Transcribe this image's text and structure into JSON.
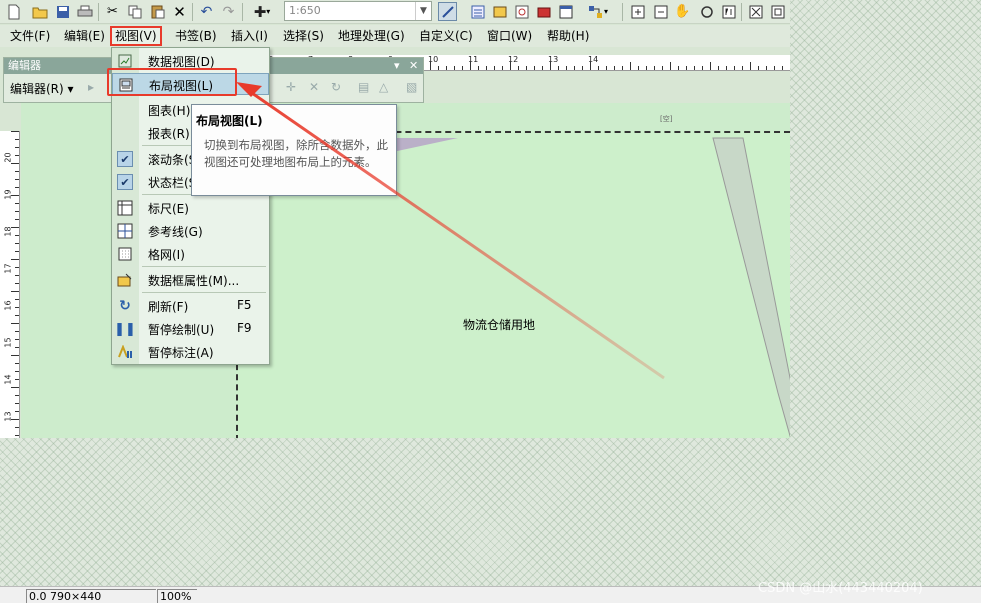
{
  "toolbar": {
    "scale_value": "1:650",
    "icons": [
      "new-icon",
      "open-icon",
      "save-icon",
      "print-icon",
      "cut-icon",
      "copy-icon",
      "paste-icon",
      "delete-icon",
      "undo-icon",
      "redo-icon",
      "add-data-icon",
      "editor-toolbar-icon",
      "table-of-contents-icon",
      "catalog-icon",
      "search-window-icon",
      "arctoolbox-icon",
      "python-icon",
      "model-builder-icon",
      "zoom-in-icon",
      "zoom-out-icon",
      "pan-icon",
      "full-extent-icon",
      "fixed-zoom-icon",
      "select-elements-icon",
      "page-extent-icon"
    ]
  },
  "menubar": {
    "items": [
      "文件(F)",
      "编辑(E)",
      "视图(V)",
      "书签(B)",
      "插入(I)",
      "选择(S)",
      "地理处理(G)",
      "自定义(C)",
      "窗口(W)",
      "帮助(H)"
    ]
  },
  "editor_toolbar": {
    "title": "编辑器",
    "editor_menu": "编辑器(R)"
  },
  "view_menu": {
    "items": [
      {
        "label": "数据视图(D)",
        "shortcut": "",
        "icon": "data-view-icon"
      },
      {
        "label": "布局视图(L)",
        "shortcut": "",
        "icon": "layout-view-icon"
      },
      {
        "label": "图表(H)",
        "shortcut": "",
        "icon": ""
      },
      {
        "label": "报表(R)",
        "shortcut": "",
        "icon": ""
      },
      {
        "label": "滚动条(S)",
        "shortcut": "",
        "icon": "check-icon"
      },
      {
        "label": "状态栏(S)",
        "shortcut": "",
        "icon": "check-icon"
      },
      {
        "label": "标尺(E)",
        "shortcut": "",
        "icon": "ruler-icon"
      },
      {
        "label": "参考线(G)",
        "shortcut": "",
        "icon": "guides-icon"
      },
      {
        "label": "格网(I)",
        "shortcut": "",
        "icon": "grid-icon"
      },
      {
        "label": "数据框属性(M)...",
        "shortcut": "",
        "icon": "data-frame-properties-icon"
      },
      {
        "label": "刷新(F)",
        "shortcut": "F5",
        "icon": "refresh-icon"
      },
      {
        "label": "暂停绘制(U)",
        "shortcut": "F9",
        "icon": "pause-drawing-icon"
      },
      {
        "label": "暂停标注(A)",
        "shortcut": "",
        "icon": "pause-labeling-icon"
      }
    ]
  },
  "tooltip": {
    "title": "布局视图(L)",
    "body": "切换到布局视图，除所含数据外，此视图还可处理地图布局上的元素。"
  },
  "ruler": {
    "top_numbers": [
      "6",
      "7",
      "8",
      "9",
      "10",
      "11",
      "12",
      "13",
      "14"
    ],
    "left_numbers": [
      "20",
      "19",
      "18",
      "17",
      "16",
      "15",
      "14",
      "13"
    ]
  },
  "map": {
    "label": "物流仓储用地",
    "top_marker": "[空]"
  },
  "status_bar": {
    "coordinates": "0.0 790×440",
    "zoom": "100%"
  },
  "watermark": "CSDN @山水(443440204)",
  "colors": {
    "annotation_red": "#e83a2b",
    "map_fill": "#cdf0cb",
    "road_fill": "#c8d8c8"
  }
}
